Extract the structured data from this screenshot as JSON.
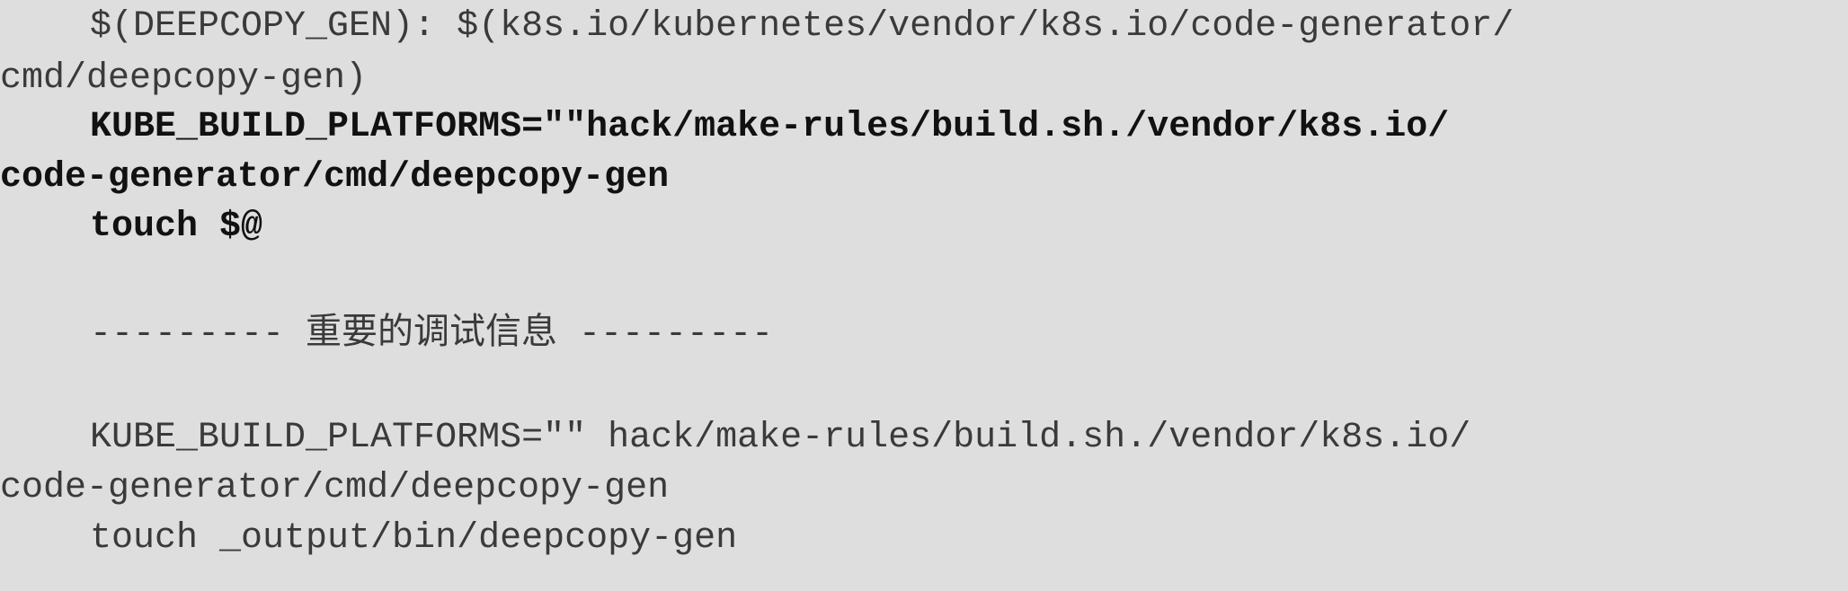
{
  "code": {
    "lines": [
      {
        "text": "$(DEEPCOPY_GEN): $(k8s.io/kubernetes/vendor/k8s.io/code-generator/",
        "bold": false,
        "indent": true
      },
      {
        "text": "cmd/deepcopy-gen)",
        "bold": false,
        "indent": false
      },
      {
        "text": "KUBE_BUILD_PLATFORMS=\"\"hack/make-rules/build.sh./vendor/k8s.io/",
        "bold": true,
        "indent": true
      },
      {
        "text": "code-generator/cmd/deepcopy-gen",
        "bold": true,
        "indent": false
      },
      {
        "text": "touch $@",
        "bold": true,
        "indent": true
      },
      {
        "text": "",
        "bold": false,
        "indent": false
      },
      {
        "text": "--------- 重要的调试信息 ---------",
        "bold": false,
        "indent": true
      },
      {
        "text": "",
        "bold": false,
        "indent": false
      },
      {
        "text": "KUBE_BUILD_PLATFORMS=\"\" hack/make-rules/build.sh./vendor/k8s.io/",
        "bold": false,
        "indent": true
      },
      {
        "text": "code-generator/cmd/deepcopy-gen",
        "bold": false,
        "indent": false
      },
      {
        "text": "touch _output/bin/deepcopy-gen",
        "bold": false,
        "indent": true
      }
    ]
  }
}
